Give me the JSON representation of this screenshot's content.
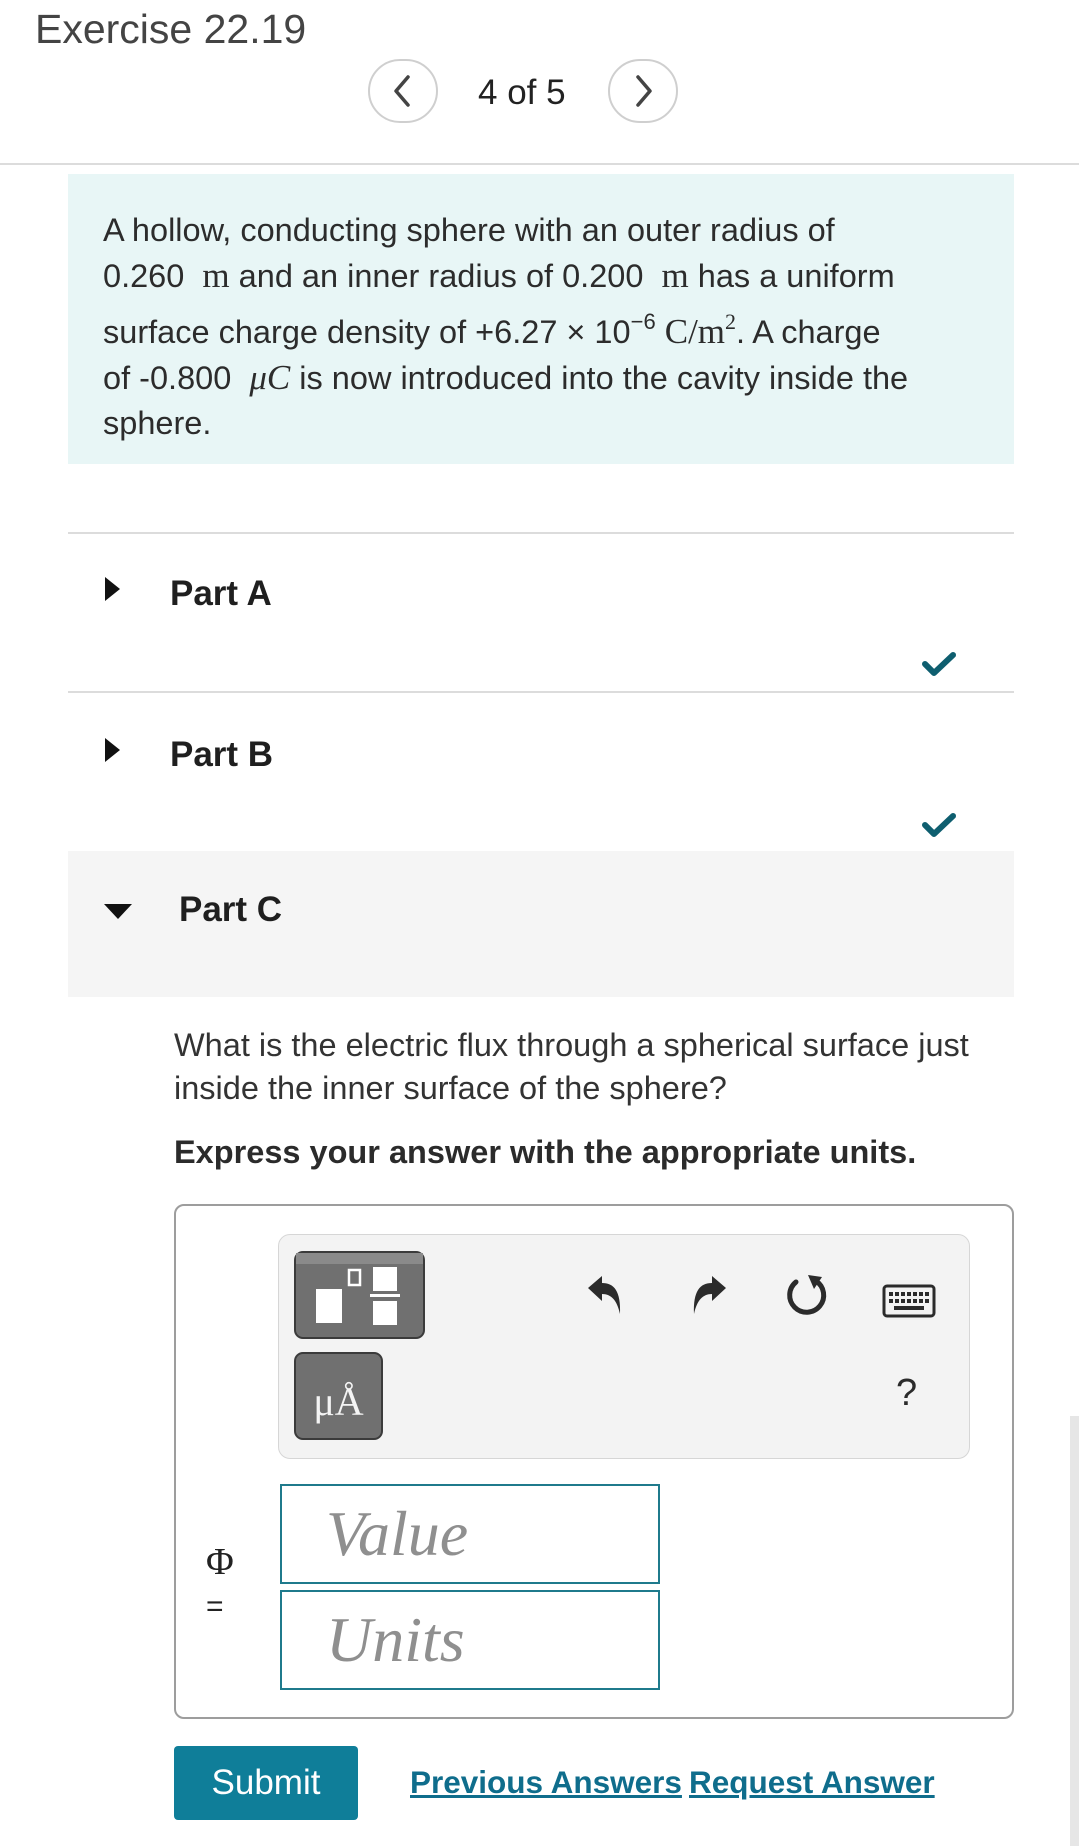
{
  "header": {
    "title": "Exercise 22.19",
    "pager": "4 of 5"
  },
  "problem": {
    "line1": "A hollow, conducting sphere with an outer radius of",
    "outer_radius": "0.260",
    "unit_m": "m",
    "inner_text": " and an inner radius of ",
    "inner_radius": "0.200",
    "uniform_text": " has a uniform",
    "density_text": "surface charge density of ",
    "density_value": "+6.27 × 10",
    "density_exp": "−6",
    "density_unit": "C/m",
    "density_unit_exp": "2",
    "charge_tail": ". A charge",
    "of_text": "of ",
    "charge_value": "-0.800",
    "charge_unit": "μC",
    "cavity_text": " is now introduced into the cavity inside the",
    "end_text": "sphere."
  },
  "parts": [
    {
      "label": "Part A",
      "completed": true
    },
    {
      "label": "Part B",
      "completed": true
    },
    {
      "label": "Part C",
      "completed": false
    }
  ],
  "part_c": {
    "question": "What is the electric flux through a spherical surface just inside the inner surface of the sphere?",
    "instruction": "Express your answer with the appropriate units.",
    "symbol": "Φ",
    "equals": "=",
    "value_placeholder": "Value",
    "units_placeholder": "Units",
    "units_button": "μÅ",
    "help": "?"
  },
  "actions": {
    "submit": "Submit",
    "previous_answers": "Previous Answers",
    "request_answer": "Request Answer"
  },
  "colors": {
    "accent": "#0f7e99",
    "check": "#0e5e6f",
    "problem_bg": "#e8f6f6"
  },
  "icons": [
    "chevron-left-icon",
    "chevron-right-icon",
    "caret-right-icon",
    "caret-down-icon",
    "checkmark-icon",
    "template-icon",
    "undo-icon",
    "redo-icon",
    "reset-icon",
    "keyboard-icon"
  ]
}
